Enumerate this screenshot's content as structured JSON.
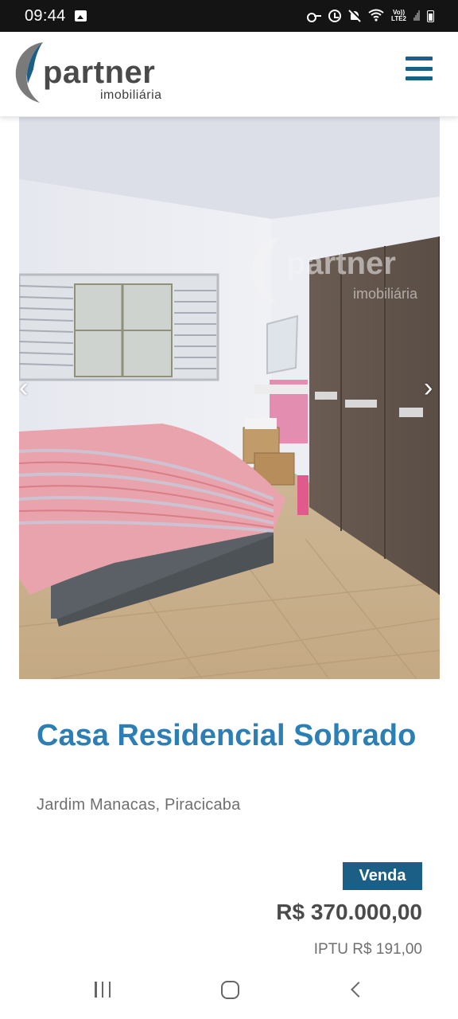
{
  "status_bar": {
    "time": "09:44",
    "icons": [
      "gallery-icon",
      "key-icon",
      "alarm-icon",
      "mute-icon",
      "wifi-icon",
      "volte-icon",
      "signal-icon",
      "battery-icon"
    ],
    "volte_line1": "Vo))",
    "volte_line2": "LTE2"
  },
  "header": {
    "logo_text": "partner",
    "logo_subtext": "imobiliária",
    "menu_icon": "hamburger-menu-icon",
    "brand_color": "#1c5f86"
  },
  "gallery": {
    "prev_icon": "chevron-left-icon",
    "next_icon": "chevron-right-icon",
    "prev_glyph": "‹",
    "next_glyph": "›",
    "watermark_text": "partner",
    "watermark_subtext": "imobiliária"
  },
  "listing": {
    "title": "Casa Residencial Sobrado",
    "location": "Jardim Manacas, Piracicaba",
    "badge": "Venda",
    "price": "R$ 370.000,00",
    "iptu": "IPTU R$ 191,00",
    "title_color": "#2b7fb5"
  },
  "nav_bar": {
    "icons": [
      "recent-apps-icon",
      "home-icon",
      "back-icon"
    ]
  }
}
